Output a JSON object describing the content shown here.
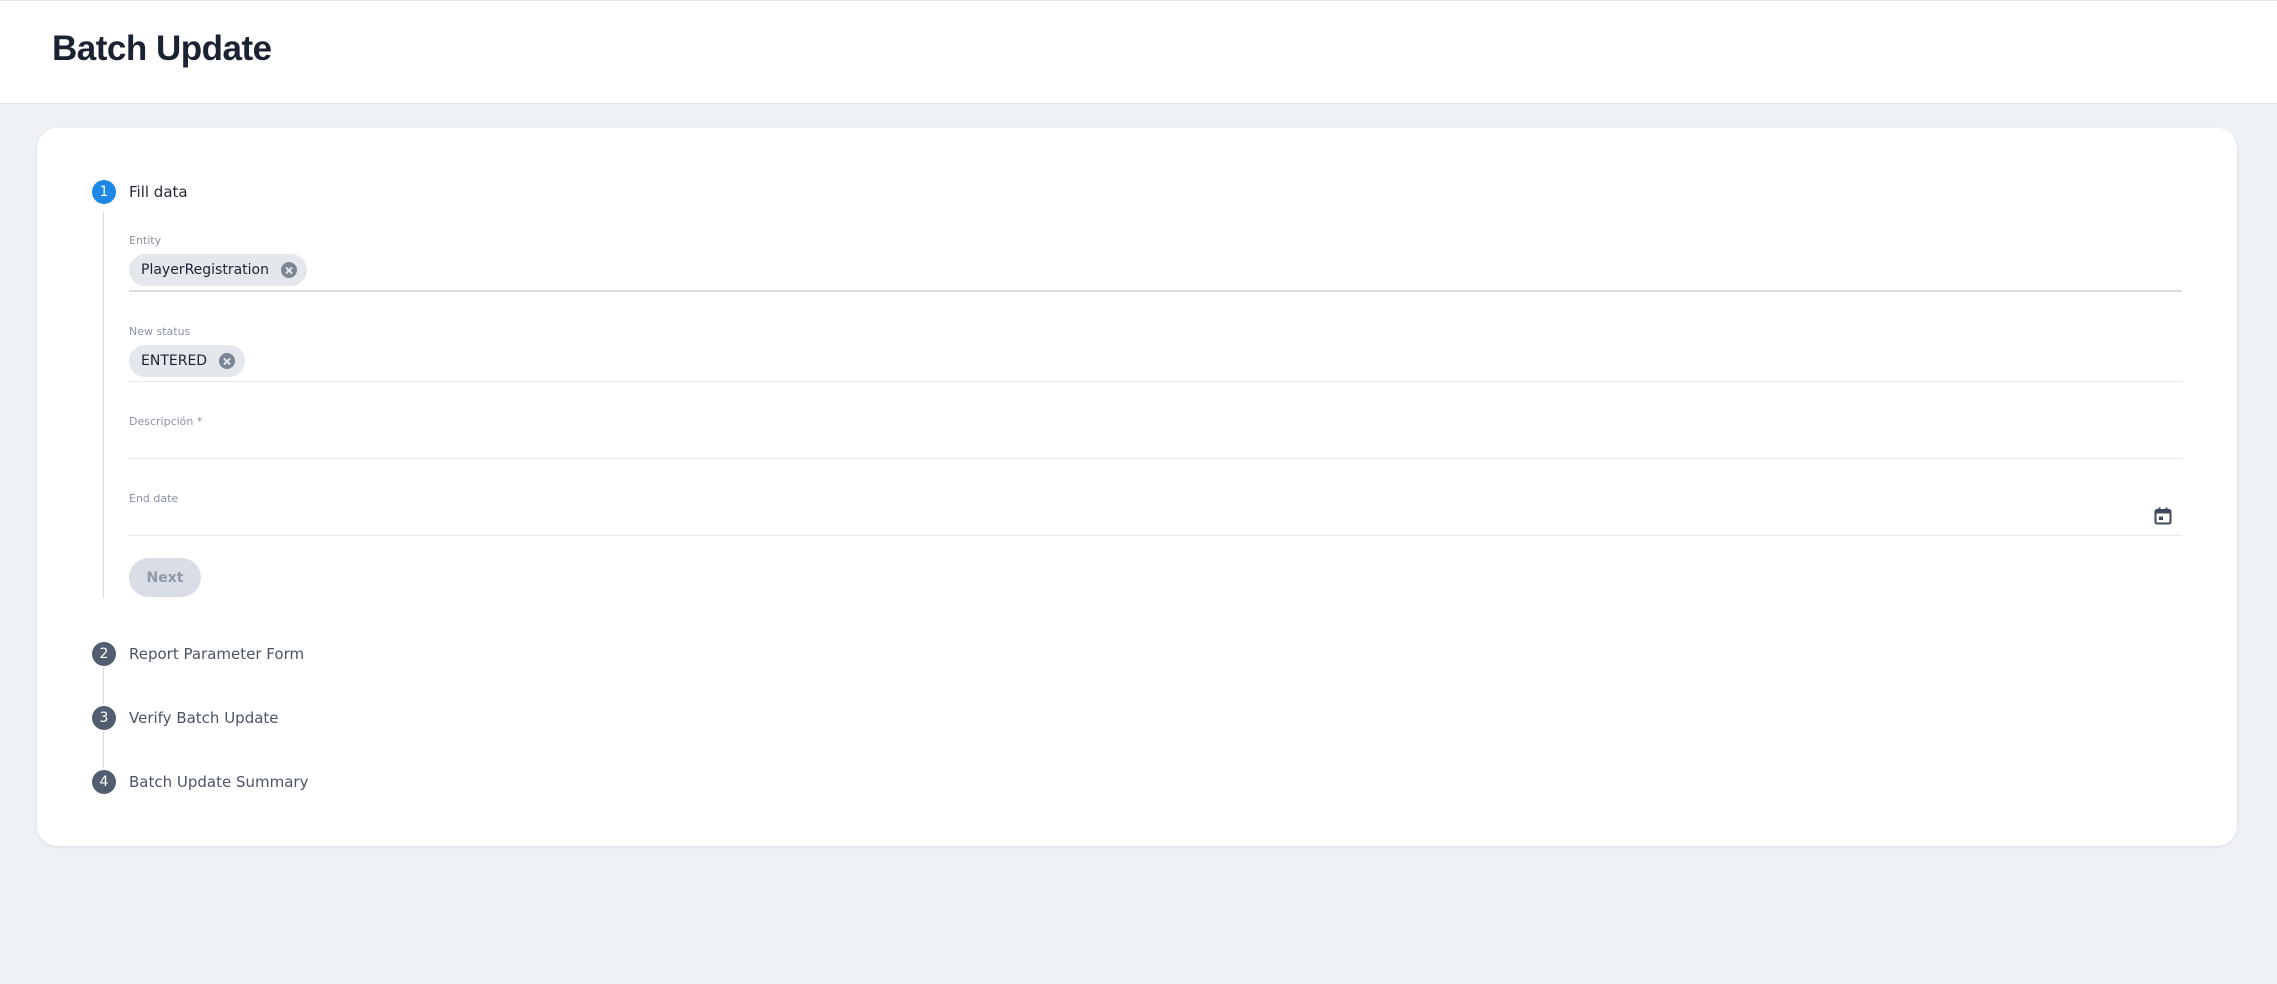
{
  "header": {
    "title": "Batch Update"
  },
  "stepper": {
    "steps": [
      {
        "number": "1",
        "label": "Fill data",
        "state": "active"
      },
      {
        "number": "2",
        "label": "Report Parameter Form",
        "state": "inactive"
      },
      {
        "number": "3",
        "label": "Verify Batch Update",
        "state": "inactive"
      },
      {
        "number": "4",
        "label": "Batch Update Summary",
        "state": "inactive"
      }
    ]
  },
  "form": {
    "entity": {
      "label": "Entity",
      "value": "PlayerRegistration"
    },
    "new_status": {
      "label": "New status",
      "value": "ENTERED"
    },
    "description": {
      "label": "Descripción *",
      "value": ""
    },
    "end_date": {
      "label": "End date",
      "value": "",
      "icon": "calendar-icon"
    },
    "next_label": "Next"
  },
  "colors": {
    "accent": "#1e88e5",
    "step_inactive": "#525e70",
    "page_background": "#eef1f6"
  }
}
